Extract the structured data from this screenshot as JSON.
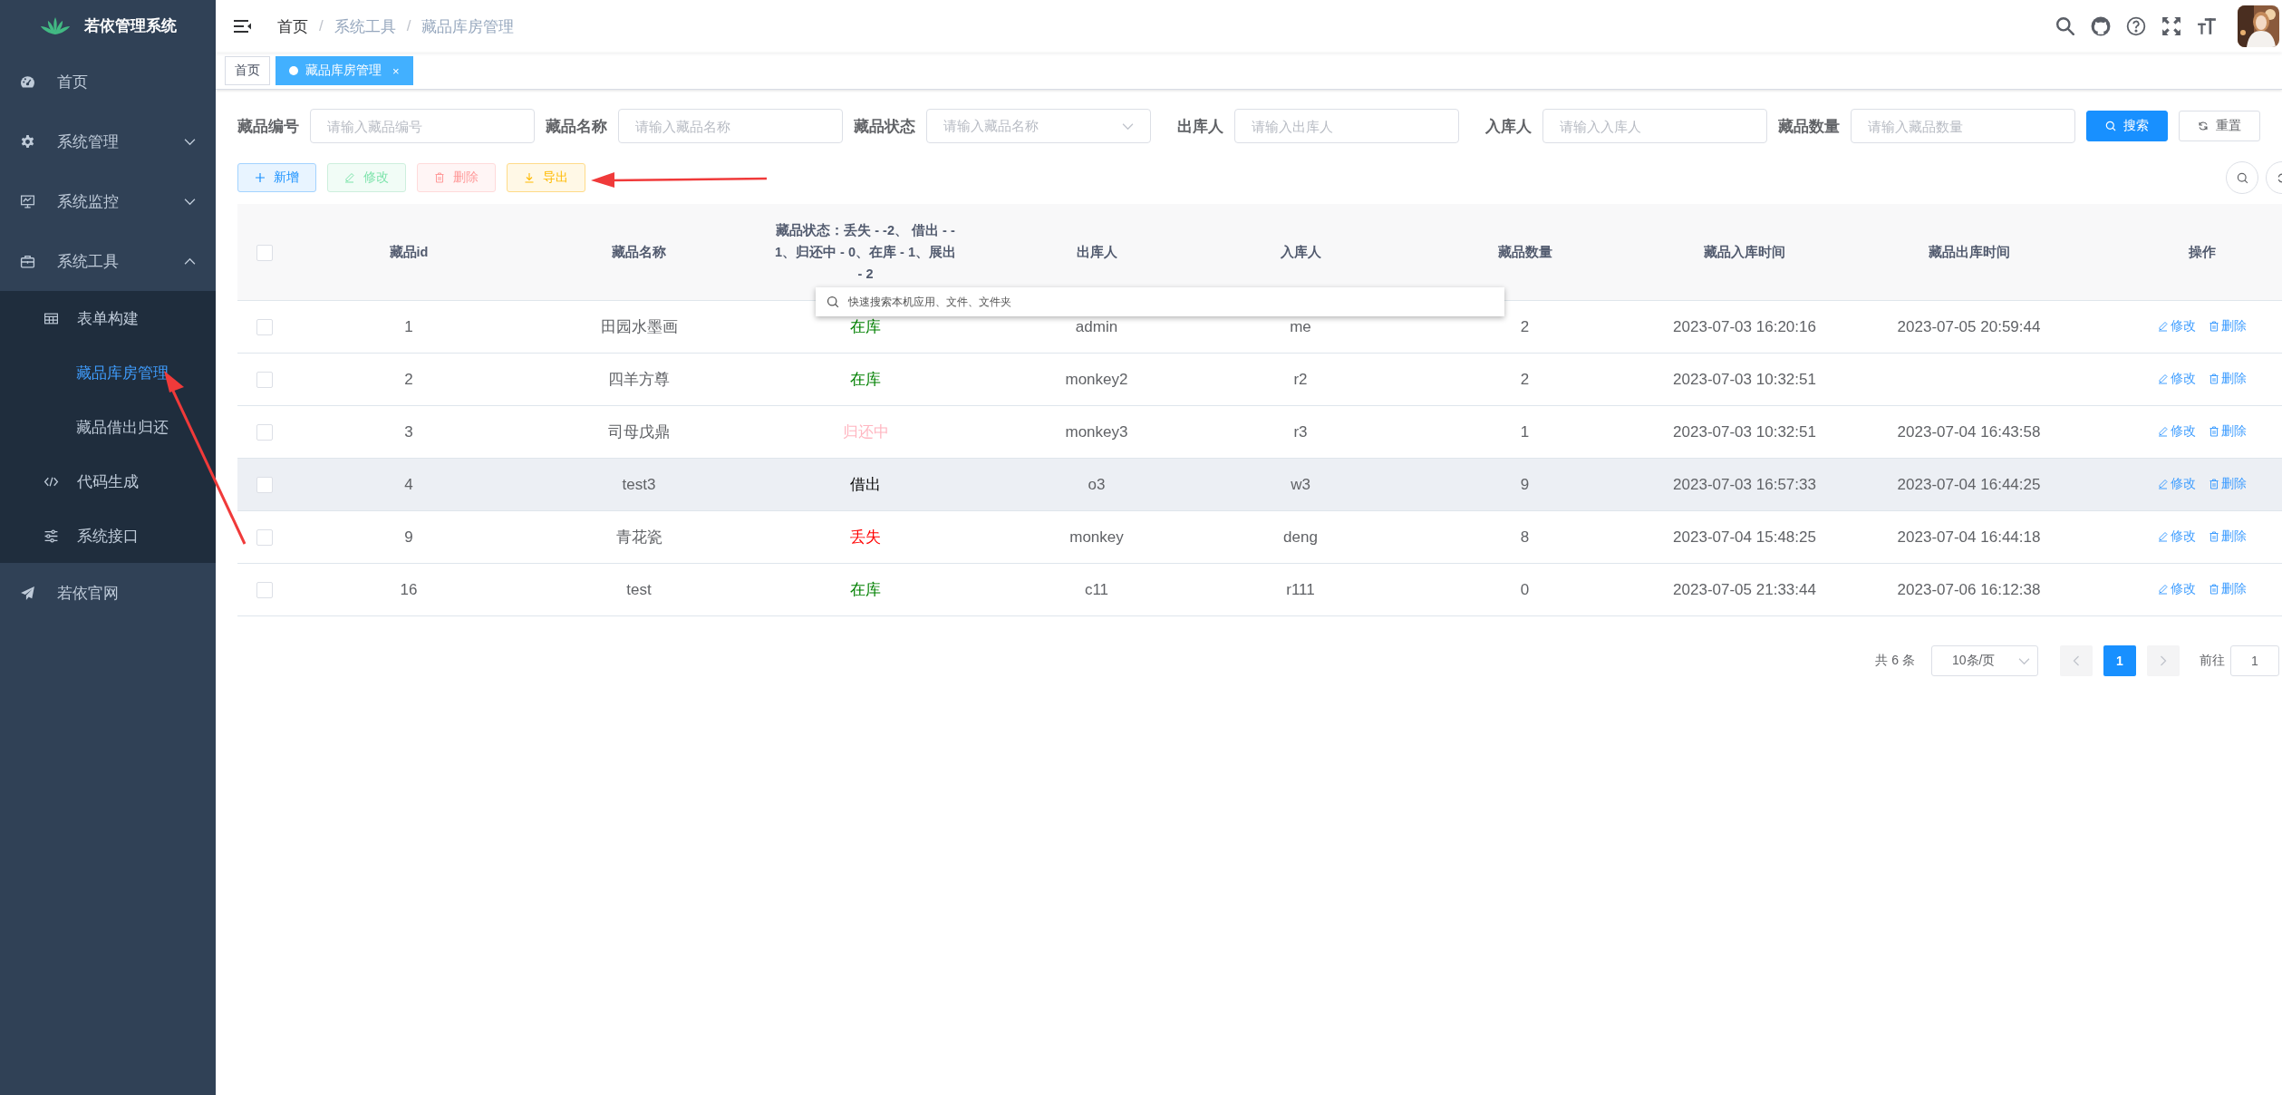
{
  "sidebar": {
    "title": "若依管理系统",
    "items": [
      {
        "label": "首页",
        "kind": "link",
        "selected": false
      },
      {
        "label": "系统管理",
        "kind": "submenu",
        "expanded": false,
        "selected": false
      },
      {
        "label": "系统监控",
        "kind": "submenu",
        "expanded": false,
        "selected": false
      },
      {
        "label": "系统工具",
        "kind": "submenu",
        "expanded": true,
        "selected": false,
        "children": [
          {
            "label": "表单构建",
            "selected": false
          },
          {
            "label": "藏品库房管理",
            "selected": true
          },
          {
            "label": "藏品借出归还",
            "selected": false
          },
          {
            "label": "代码生成",
            "selected": false
          },
          {
            "label": "系统接口",
            "selected": false
          }
        ]
      },
      {
        "label": "若依官网",
        "kind": "link",
        "selected": false
      }
    ]
  },
  "breadcrumb": [
    {
      "label": "首页",
      "link": true
    },
    {
      "label": "系统工具",
      "link": false
    },
    {
      "label": "藏品库房管理",
      "link": false
    }
  ],
  "breadcrumb_separator": "/",
  "tags": [
    {
      "label": "首页",
      "selected": false
    },
    {
      "label": "藏品库房管理",
      "selected": true,
      "close": "×"
    }
  ],
  "filters": [
    {
      "label": "藏品编号",
      "placeholder": "请输入藏品编号",
      "kind": "input"
    },
    {
      "label": "藏品名称",
      "placeholder": "请输入藏品名称",
      "kind": "input"
    },
    {
      "label": "藏品状态",
      "placeholder": "请输入藏品名称",
      "kind": "select"
    },
    {
      "label": "出库人",
      "placeholder": "请输入出库人",
      "kind": "input"
    },
    {
      "label": "入库人",
      "placeholder": "请输入入库人",
      "kind": "input"
    },
    {
      "label": "藏品数量",
      "placeholder": "请输入藏品数量",
      "kind": "input"
    }
  ],
  "search_button": "搜索",
  "reset_button": "重置",
  "toolbar": [
    {
      "label": "新增",
      "kind": "primary",
      "disabled": false
    },
    {
      "label": "修改",
      "kind": "success",
      "disabled": true
    },
    {
      "label": "删除",
      "kind": "danger",
      "disabled": true
    },
    {
      "label": "导出",
      "kind": "warning",
      "disabled": false
    }
  ],
  "table": {
    "all_checked": false,
    "columns": [
      "藏品id",
      "藏品名称",
      "藏品状态：丢失 - -2、 借出 - - 1、归还中 - 0、在库 - 1、展出 - 2",
      "出库人",
      "入库人",
      "藏品数量",
      "藏品入库时间",
      "藏品出库时间",
      "操作"
    ],
    "rows": [
      {
        "checked": false,
        "hovered": false,
        "id": "1",
        "name": "田园水墨画",
        "status": {
          "text": "在库",
          "color": "#008000"
        },
        "out_person": "admin",
        "in_person": "me",
        "quantity": "2",
        "in_time": "2023-07-03 16:20:16",
        "out_time": "2023-07-05 20:59:44",
        "actions": [
          "修改",
          "删除"
        ]
      },
      {
        "checked": false,
        "hovered": false,
        "id": "2",
        "name": "四羊方尊",
        "status": {
          "text": "在库",
          "color": "#008000"
        },
        "out_person": "monkey2",
        "in_person": "r2",
        "quantity": "2",
        "in_time": "2023-07-03 10:32:51",
        "actions": [
          "修改",
          "删除"
        ]
      },
      {
        "checked": false,
        "hovered": false,
        "id": "3",
        "name": "司母戊鼎",
        "status": {
          "text": "归还中",
          "color": "#ffb6c1"
        },
        "out_person": "monkey3",
        "in_person": "r3",
        "quantity": "1",
        "in_time": "2023-07-03 10:32:51",
        "out_time": "2023-07-04 16:43:58",
        "actions": [
          "修改",
          "删除"
        ]
      },
      {
        "checked": false,
        "hovered": true,
        "id": "4",
        "name": "test3",
        "status": {
          "text": "借出",
          "color": "#000000"
        },
        "out_person": "o3",
        "in_person": "w3",
        "quantity": "9",
        "in_time": "2023-07-03 16:57:33",
        "out_time": "2023-07-04 16:44:25",
        "actions": [
          "修改",
          "删除"
        ]
      },
      {
        "checked": false,
        "hovered": false,
        "id": "9",
        "name": "青花瓷",
        "status": {
          "text": "丢失",
          "color": "#ff0000"
        },
        "out_person": "monkey",
        "in_person": "deng",
        "quantity": "8",
        "in_time": "2023-07-04 15:48:25",
        "out_time": "2023-07-04 16:44:18",
        "actions": [
          "修改",
          "删除"
        ]
      },
      {
        "checked": false,
        "hovered": false,
        "id": "16",
        "name": "test",
        "status": {
          "text": "在库",
          "color": "#008000"
        },
        "out_person": "c11",
        "in_person": "r111",
        "quantity": "0",
        "in_time": "2023-07-05 21:33:44",
        "out_time": "2023-07-06 16:12:38",
        "actions": [
          "修改",
          "删除"
        ]
      }
    ]
  },
  "pagination": {
    "total": "共 6 条",
    "page_size": "10条/页",
    "pages": [
      {
        "label": "1",
        "selected": true
      }
    ],
    "goto_label": "前往",
    "goto_value": "1"
  },
  "quick_search": {
    "placeholder": "快速搜索本机应用、文件、文件夹"
  }
}
